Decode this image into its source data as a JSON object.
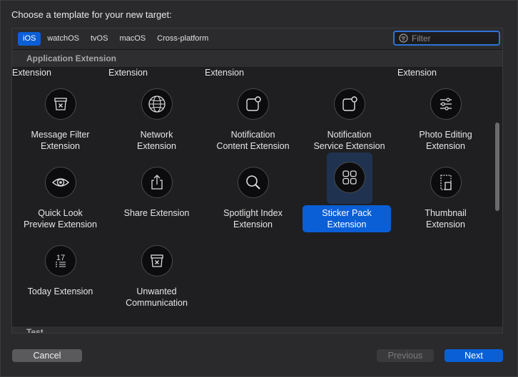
{
  "dialog": {
    "prompt": "Choose a template for your new target:"
  },
  "platform_tabs": [
    "iOS",
    "watchOS",
    "tvOS",
    "macOS",
    "Cross-platform"
  ],
  "active_tab": "iOS",
  "filter": {
    "placeholder": "Filter",
    "value": ""
  },
  "section": {
    "title": "Application Extension",
    "next_title": "Test"
  },
  "partial_row": [
    "Extension",
    "Extension",
    "Extension",
    "Extension"
  ],
  "templates": [
    {
      "line1": "Message Filter",
      "line2": "Extension",
      "icon": "message-filter-icon"
    },
    {
      "line1": "Network",
      "line2": "Extension",
      "icon": "network-icon"
    },
    {
      "line1": "Notification",
      "line2": "Content Extension",
      "icon": "notification-content-icon"
    },
    {
      "line1": "Notification",
      "line2": "Service Extension",
      "icon": "notification-service-icon"
    },
    {
      "line1": "Photo Editing",
      "line2": "Extension",
      "icon": "photo-editing-icon"
    },
    {
      "line1": "Quick Look",
      "line2": "Preview Extension",
      "icon": "quick-look-icon"
    },
    {
      "line1": "Share Extension",
      "line2": "",
      "icon": "share-icon"
    },
    {
      "line1": "Spotlight Index",
      "line2": "Extension",
      "icon": "spotlight-icon"
    },
    {
      "line1": "Sticker Pack",
      "line2": "Extension",
      "icon": "sticker-pack-icon",
      "selected": true
    },
    {
      "line1": "Thumbnail",
      "line2": "Extension",
      "icon": "thumbnail-icon"
    },
    {
      "line1": "Today Extension",
      "line2": "",
      "icon": "today-icon"
    },
    {
      "line1": "Unwanted",
      "line2": "Communication",
      "icon": "unwanted-communication-icon"
    }
  ],
  "today_icon_date": "17",
  "buttons": {
    "cancel": "Cancel",
    "previous": "Previous",
    "next": "Next"
  },
  "colors": {
    "accent": "#0a5fd6",
    "selection_bg": "#1f3350"
  }
}
